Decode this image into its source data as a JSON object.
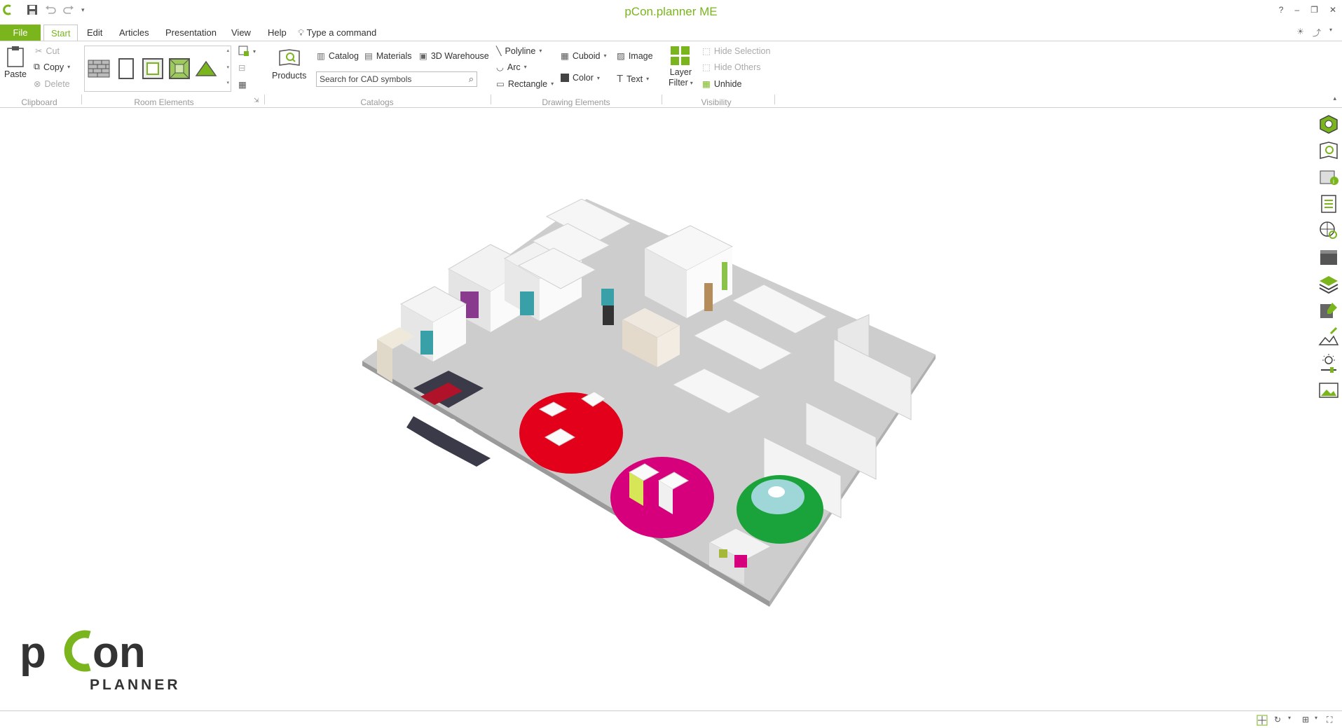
{
  "app": {
    "title": "pCon.planner ME"
  },
  "window_controls": {
    "help": "?",
    "minimize": "–",
    "restore": "❐",
    "close": "✕"
  },
  "menu": {
    "file": "File",
    "tabs": [
      "Start",
      "Edit",
      "Articles",
      "Presentation",
      "View",
      "Help"
    ],
    "active_tab": "Start",
    "command_label": "Type a command"
  },
  "ribbon": {
    "clipboard": {
      "paste": "Paste",
      "cut": "Cut",
      "copy": "Copy",
      "delete": "Delete",
      "label": "Clipboard"
    },
    "room_elements": {
      "label": "Room Elements"
    },
    "catalogs": {
      "products": "Products",
      "catalog": "Catalog",
      "materials": "Materials",
      "warehouse": "3D Warehouse",
      "search_placeholder": "Search for CAD symbols",
      "label": "Catalogs"
    },
    "drawing": {
      "polyline": "Polyline",
      "arc": "Arc",
      "rectangle": "Rectangle",
      "cuboid": "Cuboid",
      "color": "Color",
      "image": "Image",
      "text": "Text",
      "label": "Drawing Elements"
    },
    "layer_filter": {
      "line1": "Layer",
      "line2": "Filter"
    },
    "visibility": {
      "hide_selection": "Hide Selection",
      "hide_others": "Hide Others",
      "unhide": "Unhide",
      "label": "Visibility"
    }
  },
  "logo": {
    "top": "pCon",
    "bottom": "PLANNER"
  },
  "colors": {
    "accent": "#7ab51d",
    "floor": "#c9c9c9",
    "red_rug": "#e2001a",
    "magenta_rug": "#d6007d",
    "green_rug": "#1aa33a",
    "petrol": "#3aa0a8"
  },
  "right_toolbar_icons": [
    "cube-settings-icon",
    "catalog-search-icon",
    "article-info-icon",
    "article-list-icon",
    "globe-search-icon",
    "archive-box-icon",
    "layers-icon",
    "material-edit-icon",
    "terrain-edit-icon",
    "light-settings-icon",
    "image-gallery-icon"
  ]
}
